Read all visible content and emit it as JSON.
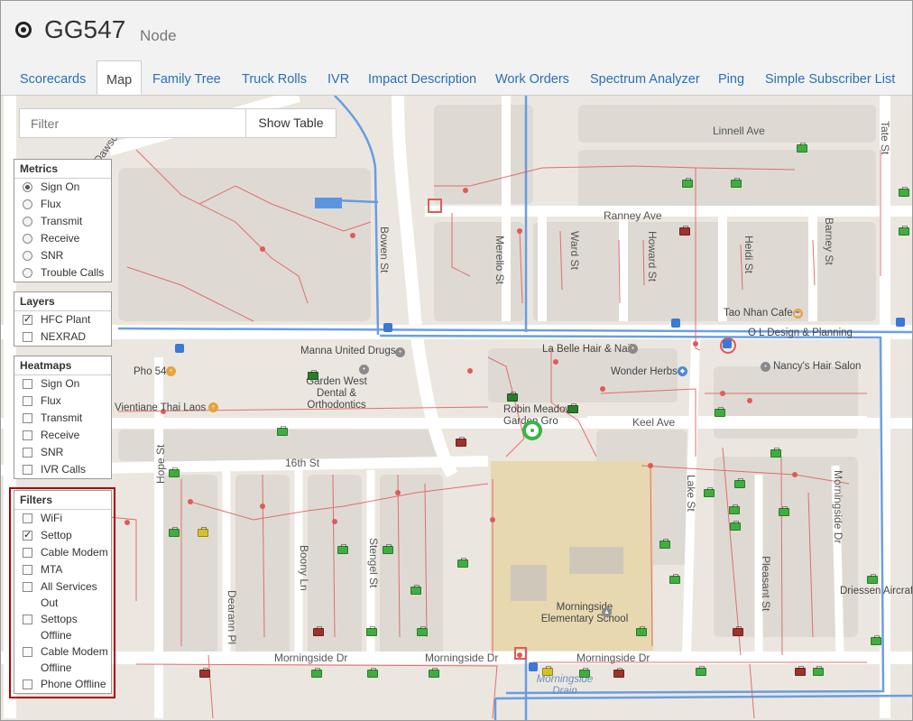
{
  "header": {
    "title": "GG547",
    "subtitle": "Node"
  },
  "tabs": [
    "Scorecards",
    "Map",
    "Family Tree",
    "Truck Rolls",
    "IVR",
    "Impact Description",
    "Work Orders",
    "Spectrum Analyzer",
    "Ping",
    "Simple Subscriber List"
  ],
  "active_tab": "Map",
  "filter_input": {
    "placeholder": "Filter",
    "value": ""
  },
  "show_table_label": "Show Table",
  "metrics": {
    "title": "Metrics",
    "items": [
      "Sign On",
      "Flux",
      "Transmit",
      "Receive",
      "SNR",
      "Trouble Calls"
    ],
    "selected": "Sign On"
  },
  "layers": {
    "title": "Layers",
    "items": [
      "HFC Plant",
      "NEXRAD"
    ],
    "checked": [
      "HFC Plant"
    ]
  },
  "heatmaps": {
    "title": "Heatmaps",
    "items": [
      "Sign On",
      "Flux",
      "Transmit",
      "Receive",
      "SNR",
      "IVR Calls"
    ]
  },
  "filters": {
    "title": "Filters",
    "items": [
      "WiFi",
      "Settop",
      "Cable Modem",
      "MTA",
      "All Services Out",
      "Settops Offline",
      "Cable Modem Offline",
      "Phone Offline"
    ],
    "checked": [
      "Settop"
    ]
  },
  "streets": [
    "Linnell Ave",
    "Ranney Ave",
    "Bowen St",
    "Merello St",
    "Ward St",
    "Howard St",
    "Heidi St",
    "Barney St",
    "Keel Ave",
    "16th St",
    "Hope St",
    "Dearann Pl",
    "Boony Ln",
    "Stengel St",
    "Lake St",
    "Pleasant St",
    "Morningside Dr",
    "Dawson St",
    "Tate St"
  ],
  "places": [
    "Manna United Drugs",
    "Garden West Dental & Orthodontics",
    "Pho 54",
    "Vientiane Thai Laos",
    "La Belle Hair & Nail",
    "Wonder Herbs",
    "Robin Meadow Garden Gro",
    "Tao Nhan Cafe",
    "O L Design & Planning",
    "Nancy's Hair Salon",
    "Morningside Elementary School",
    "Driessen Aircraft",
    "Morningside Drain"
  ],
  "colors": {
    "online": "#3fae3f",
    "offline": "#a0312b",
    "warning": "#d4c12a",
    "plant": "#e05a5a",
    "fiber": "#5b95e0",
    "link": "#2a6ebb"
  }
}
